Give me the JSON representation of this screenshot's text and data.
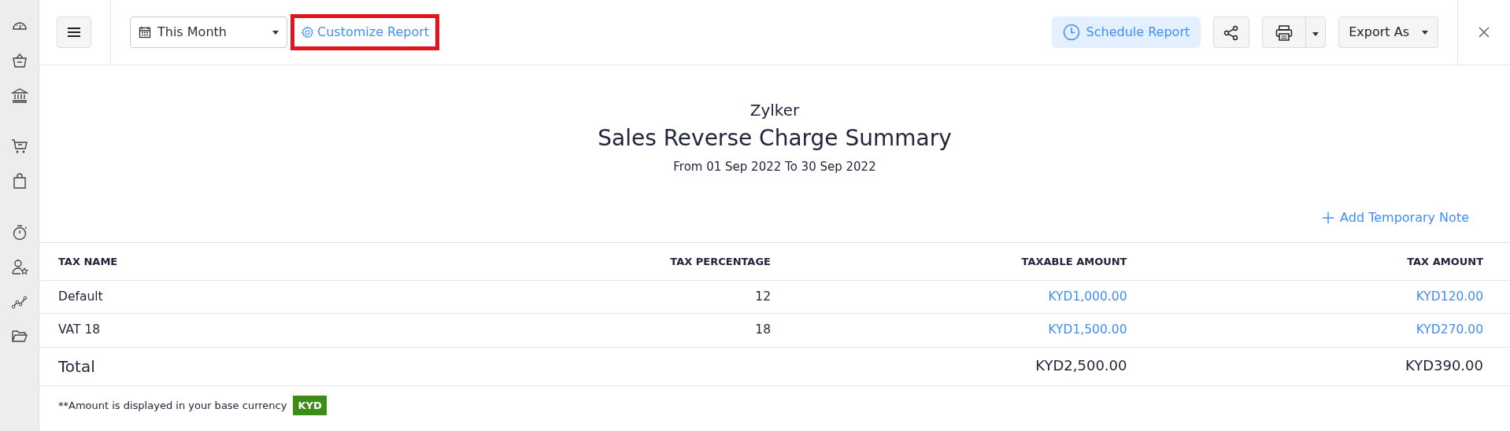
{
  "sidebar": {
    "groups": [
      {
        "items": [
          {
            "kind": "gauge"
          },
          {
            "kind": "basket"
          },
          {
            "kind": "bank"
          }
        ]
      },
      {
        "items": [
          {
            "kind": "cart"
          },
          {
            "kind": "bag"
          }
        ]
      },
      {
        "items": [
          {
            "kind": "timer"
          },
          {
            "kind": "user-star"
          },
          {
            "kind": "chart"
          },
          {
            "kind": "folder"
          }
        ]
      }
    ]
  },
  "toolbar": {
    "period": "This Month",
    "customize": {
      "label": "Customize Report",
      "highlighted": true
    },
    "schedule": "Schedule Report",
    "export": "Export As"
  },
  "report": {
    "company": "Zylker",
    "title": "Sales Reverse Charge Summary",
    "range": "From 01 Sep 2022 To 30 Sep 2022",
    "add_note": "Add Temporary Note"
  },
  "table": {
    "columns": [
      "TAX NAME",
      "TAX PERCENTAGE",
      "TAXABLE AMOUNT",
      "TAX AMOUNT"
    ],
    "rows": [
      [
        "Default",
        "12",
        "KYD1,000.00",
        "KYD120.00"
      ],
      [
        "VAT 18",
        "18",
        "KYD1,500.00",
        "KYD270.00"
      ]
    ],
    "total": {
      "label": "Total",
      "taxable": "KYD2,500.00",
      "tax": "KYD390.00"
    }
  },
  "footnote": {
    "text": "**Amount is displayed in your base currency",
    "currency": "KYD"
  }
}
